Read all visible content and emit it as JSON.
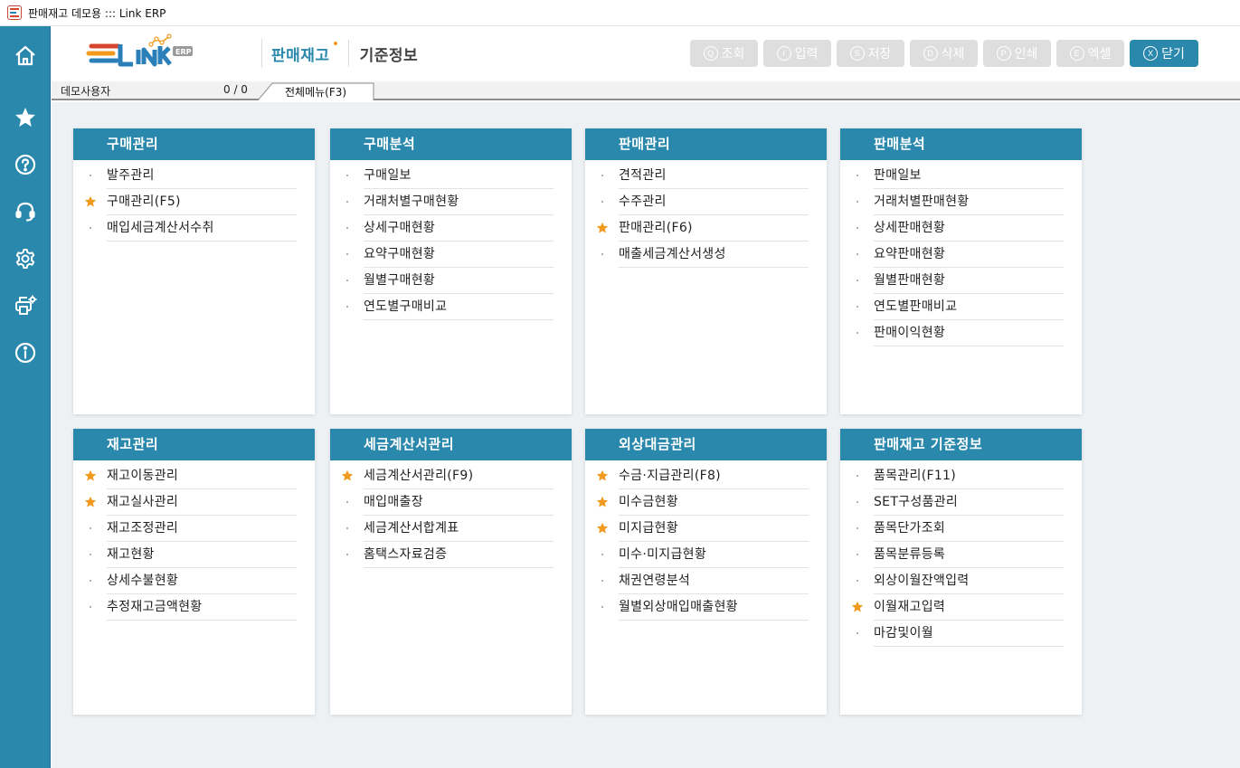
{
  "window": {
    "title": "판매재고 데모용 ::: Link ERP"
  },
  "header": {
    "module": "판매재고",
    "submodule": "기준정보",
    "toolbar": [
      {
        "key": "Q",
        "label": "조회",
        "active": false
      },
      {
        "key": "I",
        "label": "입력",
        "active": false
      },
      {
        "key": "S",
        "label": "저장",
        "active": false
      },
      {
        "key": "D",
        "label": "삭제",
        "active": false
      },
      {
        "key": "P",
        "label": "인쇄",
        "active": false
      },
      {
        "key": "E",
        "label": "엑셀",
        "active": false
      },
      {
        "key": "X",
        "label": "닫기",
        "active": true
      }
    ]
  },
  "infobar": {
    "user": "데모사용자",
    "counter": "0 / 0",
    "tab": "전체메뉴(F3)"
  },
  "colors": {
    "primary": "#2b88ad",
    "star": "#f29a1e",
    "disabled": "#dedede",
    "background": "#eef1f4"
  },
  "sidebar": [
    {
      "icon": "home-icon"
    },
    {
      "icon": "star-icon"
    },
    {
      "icon": "help-icon"
    },
    {
      "icon": "headset-icon"
    },
    {
      "icon": "gear-icon"
    },
    {
      "icon": "printer-settings-icon"
    },
    {
      "icon": "info-icon"
    }
  ],
  "panels": [
    {
      "title": "구매관리",
      "items": [
        {
          "label": "발주관리",
          "star": false
        },
        {
          "label": "구매관리(F5)",
          "star": true
        },
        {
          "label": "매입세금계산서수취",
          "star": false
        }
      ]
    },
    {
      "title": "구매분석",
      "items": [
        {
          "label": "구매일보",
          "star": false
        },
        {
          "label": "거래처별구매현황",
          "star": false
        },
        {
          "label": "상세구매현황",
          "star": false
        },
        {
          "label": "요약구매현황",
          "star": false
        },
        {
          "label": "월별구매현황",
          "star": false
        },
        {
          "label": "연도별구매비교",
          "star": false
        }
      ]
    },
    {
      "title": "판매관리",
      "items": [
        {
          "label": "견적관리",
          "star": false
        },
        {
          "label": "수주관리",
          "star": false
        },
        {
          "label": "판매관리(F6)",
          "star": true
        },
        {
          "label": "매출세금계산서생성",
          "star": false
        }
      ]
    },
    {
      "title": "판매분석",
      "items": [
        {
          "label": "판매일보",
          "star": false
        },
        {
          "label": "거래처별판매현황",
          "star": false
        },
        {
          "label": "상세판매현황",
          "star": false
        },
        {
          "label": "요약판매현황",
          "star": false
        },
        {
          "label": "월별판매현황",
          "star": false
        },
        {
          "label": "연도별판매비교",
          "star": false
        },
        {
          "label": "판매이익현황",
          "star": false
        }
      ]
    },
    {
      "title": "재고관리",
      "items": [
        {
          "label": "재고이동관리",
          "star": true
        },
        {
          "label": "재고실사관리",
          "star": true
        },
        {
          "label": "재고조정관리",
          "star": false
        },
        {
          "label": "재고현황",
          "star": false
        },
        {
          "label": "상세수불현황",
          "star": false
        },
        {
          "label": "추정재고금액현황",
          "star": false
        }
      ]
    },
    {
      "title": "세금계산서관리",
      "items": [
        {
          "label": "세금계산서관리(F9)",
          "star": true
        },
        {
          "label": "매입매출장",
          "star": false
        },
        {
          "label": "세금계산서합계표",
          "star": false
        },
        {
          "label": "홈택스자료검증",
          "star": false
        }
      ]
    },
    {
      "title": "외상대금관리",
      "items": [
        {
          "label": "수금·지급관리(F8)",
          "star": true
        },
        {
          "label": "미수금현황",
          "star": true
        },
        {
          "label": "미지급현황",
          "star": true
        },
        {
          "label": "미수·미지급현황",
          "star": false
        },
        {
          "label": "채권연령분석",
          "star": false
        },
        {
          "label": "월별외상매입매출현황",
          "star": false
        }
      ]
    },
    {
      "title": "판매재고 기준정보",
      "items": [
        {
          "label": "품목관리(F11)",
          "star": false
        },
        {
          "label": "SET구성품관리",
          "star": false
        },
        {
          "label": "품목단가조회",
          "star": false
        },
        {
          "label": "품목분류등록",
          "star": false
        },
        {
          "label": "외상이월잔액입력",
          "star": false
        },
        {
          "label": "이월재고입력",
          "star": true
        },
        {
          "label": "마감및이월",
          "star": false
        }
      ]
    }
  ]
}
